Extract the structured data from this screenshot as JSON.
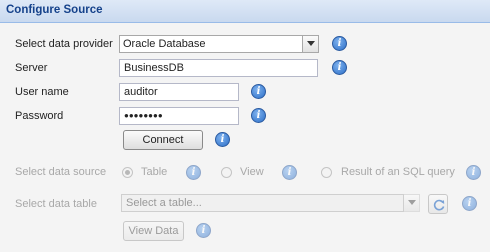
{
  "panel": {
    "title": "Configure Source"
  },
  "provider": {
    "label": "Select data provider",
    "value": "Oracle Database"
  },
  "server": {
    "label": "Server",
    "value": "BusinessDB"
  },
  "user": {
    "label": "User name",
    "value": "auditor"
  },
  "password": {
    "label": "Password",
    "value": "●●●●●●●●"
  },
  "connect": {
    "label": "Connect"
  },
  "source": {
    "label": "Select data source",
    "options": [
      {
        "label": "Table",
        "selected": true
      },
      {
        "label": "View",
        "selected": false
      },
      {
        "label": "Result of an SQL query",
        "selected": false
      }
    ]
  },
  "table": {
    "label": "Select data table",
    "placeholder": "Select a table..."
  },
  "view_data": {
    "label": "View Data"
  },
  "icons": {
    "info": "i"
  },
  "colors": {
    "header_title": "#15428b",
    "info_icon": "#2c6fc8",
    "disabled_text": "#a8a8a8"
  }
}
